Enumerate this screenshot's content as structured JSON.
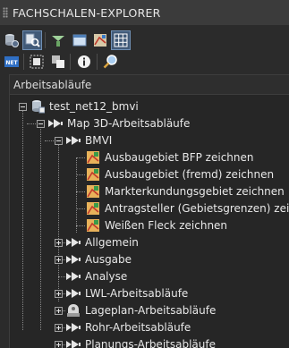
{
  "panel_title": "FACHSCHALEN-EXPLORER",
  "toolbar1": [
    {
      "name": "db-settings-icon"
    },
    {
      "name": "search-workflow-icon",
      "active": true
    },
    {
      "name": "tree-filter-icon"
    },
    {
      "name": "window-icon"
    },
    {
      "name": "map-symbol-icon"
    },
    {
      "name": "grid-icon",
      "active": true
    }
  ],
  "toolbar2": [
    {
      "name": "net-icon"
    },
    {
      "name": "select-object-icon"
    },
    {
      "name": "copy-shapes-icon"
    },
    {
      "name": "info-icon"
    },
    {
      "name": "zoom-search-icon"
    }
  ],
  "section_label": "Arbeitsabläufe",
  "tree": {
    "root": "test_net12_bmvi",
    "workflow_group": "Map 3D-Arbeitsabläufe",
    "bmvi": "BMVI",
    "bmvi_items": [
      "Ausbaugebiet BFP zeichnen",
      "Ausbaugebiet (fremd) zeichnen",
      "Markterkundungsgebiet zeichnen",
      "Antragsteller (Gebietsgrenzen) zeichnen",
      "Weißen Fleck zeichnen"
    ],
    "groups": [
      {
        "label": "Allgemein",
        "expandable": true
      },
      {
        "label": "Ausgabe",
        "expandable": true
      },
      {
        "label": "Analyse",
        "expandable": false
      },
      {
        "label": "LWL-Arbeitsabläufe",
        "expandable": true
      },
      {
        "label": "Lageplan-Arbeitsabläufe",
        "expandable": true,
        "special_icon": true
      },
      {
        "label": "Rohr-Arbeitsabläufe",
        "expandable": true
      },
      {
        "label": "Planungs-Arbeitsabläufe",
        "expandable": true
      }
    ]
  }
}
